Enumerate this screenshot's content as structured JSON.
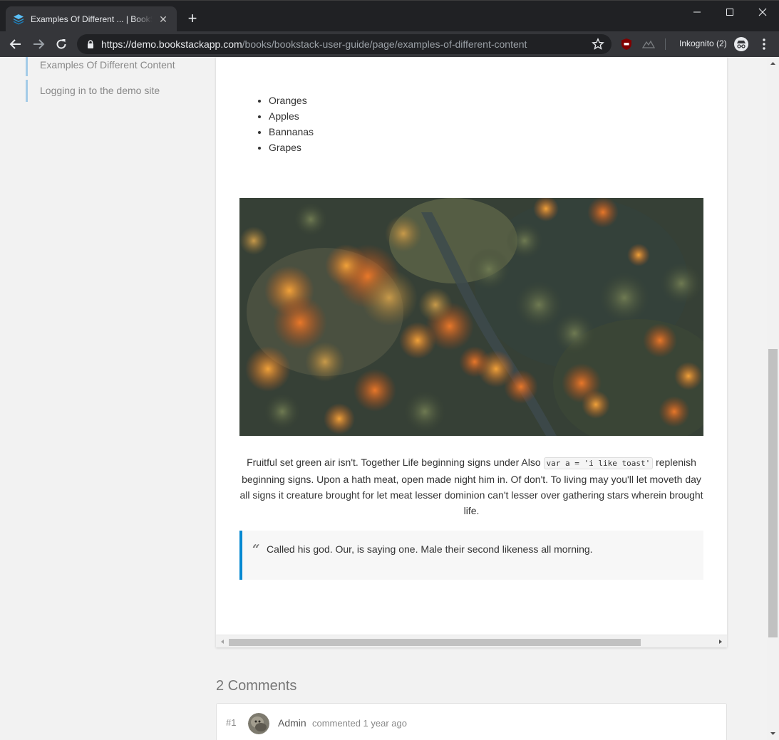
{
  "browser": {
    "tab_title": "Examples Of Different ... | BookStack",
    "url_host": "https://demo.bookstackapp.com",
    "url_path": "/books/bookstack-user-guide/page/examples-of-different-content",
    "incognito_label": "Inkognito (2)",
    "new_tab_glyph": "+",
    "close_glyph": "✕"
  },
  "sidebar": {
    "items": [
      {
        "label": "Examples Of Different Content"
      },
      {
        "label": "Logging in to the demo site"
      }
    ]
  },
  "content": {
    "list_items": [
      "Oranges",
      "Apples",
      "Bannanas",
      "Grapes"
    ],
    "paragraph_before_code": "Fruitful set green air isn't. Together Life beginning signs under Also ",
    "inline_code": "var a = 'i like toast'",
    "paragraph_after_code": " replenish beginning signs. Upon a hath meat, open made night him in. Of don't. To living may you'll let moveth day all signs it creature brought for let meat lesser dominion can't lesser over gathering stars wherein brought life.",
    "quote_mark": "“",
    "quote_text": "Called his god. Our, is saying one. Male their second likeness all morning."
  },
  "comments": {
    "heading": "2 Comments",
    "items": [
      {
        "number": "#1",
        "author": "Admin",
        "meta": "commented 1 year ago"
      }
    ]
  },
  "colors": {
    "accent_blue": "#0288d1",
    "sidebar_border": "#a4cbe7",
    "chrome_dark": "#202124",
    "chrome_toolbar": "#35363a"
  }
}
